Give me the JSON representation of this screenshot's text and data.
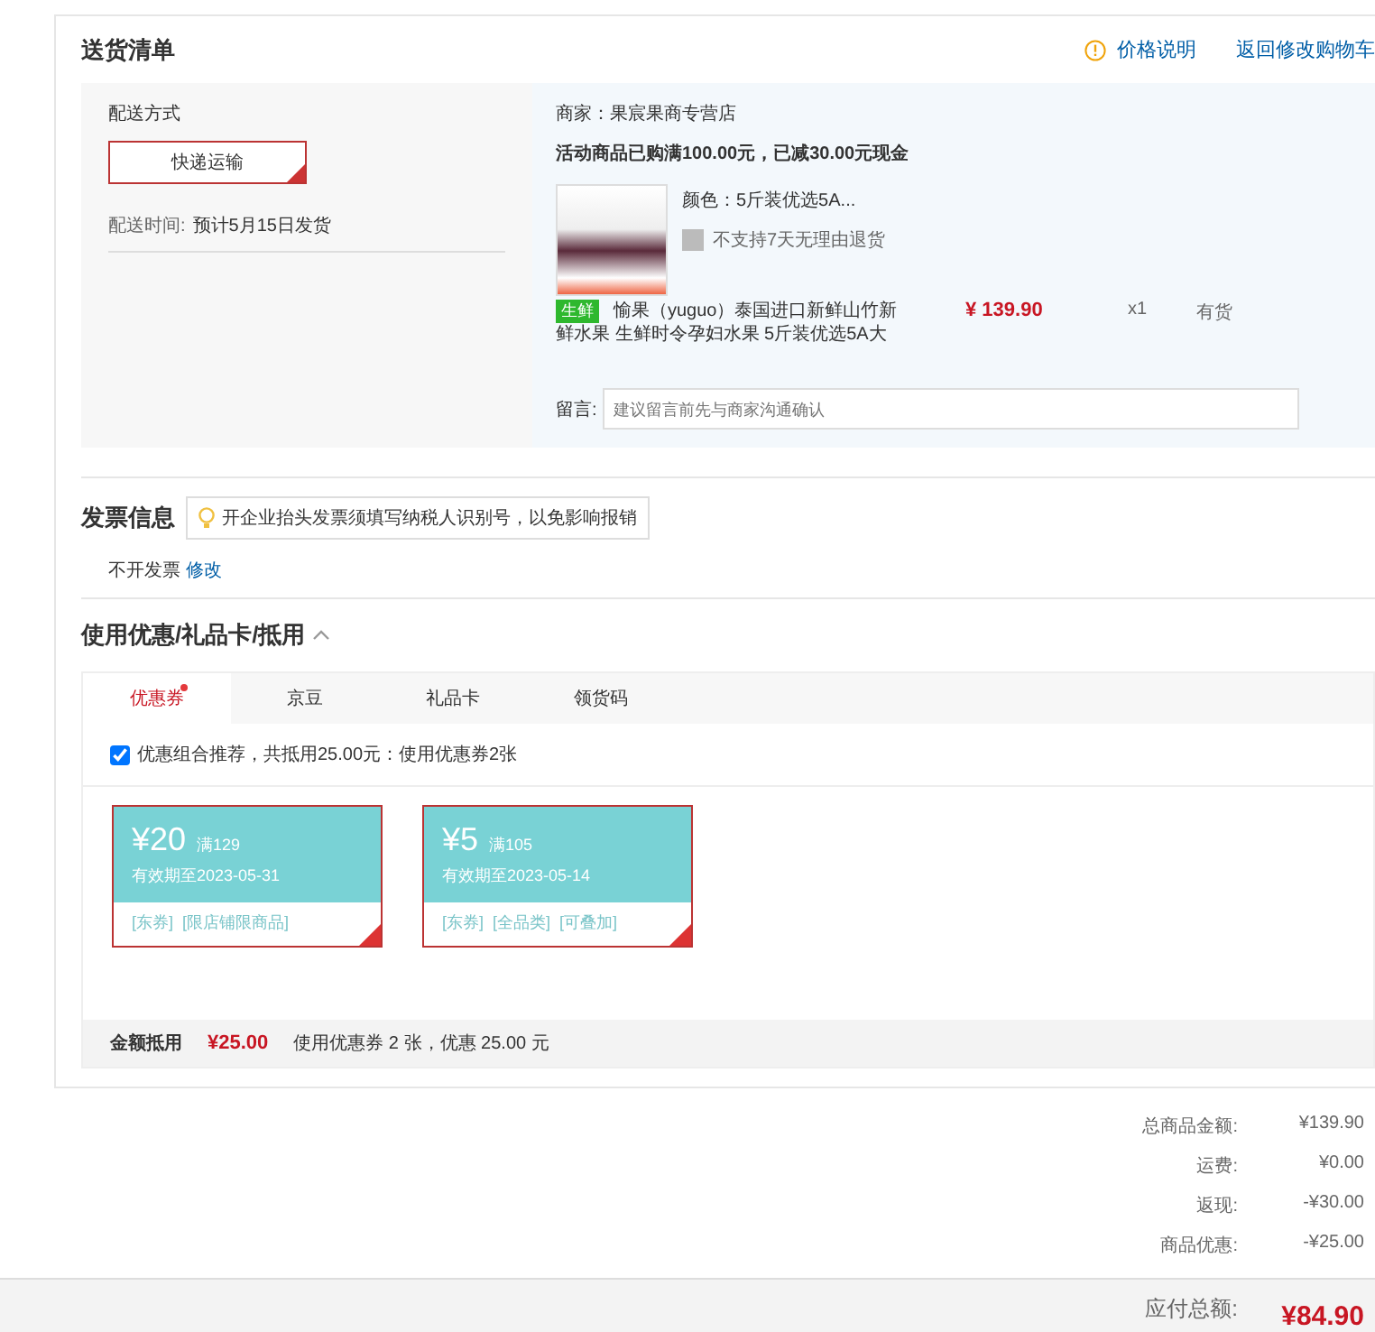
{
  "delivery": {
    "title": "送货清单",
    "links": [
      {
        "kind": "info",
        "label": "价格说明"
      },
      {
        "kind": "plain",
        "label": "返回修改购物车"
      }
    ],
    "shipping": {
      "label": "配送方式",
      "option": "快递运输",
      "selected": true,
      "time_label": "配送时间:",
      "time_value": "预计5月15日发货"
    },
    "shop": {
      "merchant": "商家：果宸果商专营店",
      "promo": "活动商品已购满100.00元，已减30.00元现金",
      "item": {
        "spec": "颜色：5斤装优选5A...",
        "no_return": "不支持7天无理由退货",
        "tag": "生鲜",
        "name": "愉果（yuguo）泰国进口新鲜山竹新鲜水果 生鲜时令孕妇水果 5斤装优选5A大",
        "price": "¥ 139.90",
        "qty": "x1",
        "stock": "有货"
      },
      "note_label": "留言:",
      "note_placeholder": "建议留言前先与商家沟通确认"
    }
  },
  "invoice": {
    "title": "发票信息",
    "tip": "开企业抬头发票须填写纳税人识别号，以免影响报销",
    "value": "不开发票",
    "edit": "修改"
  },
  "discount": {
    "title": "使用优惠/礼品卡/抵用",
    "expanded": true,
    "tabs": [
      {
        "label": "优惠券",
        "selected": true,
        "dot": true
      },
      {
        "label": "京豆",
        "selected": false,
        "dot": false
      },
      {
        "label": "礼品卡",
        "selected": false,
        "dot": false
      },
      {
        "label": "领货码",
        "selected": false,
        "dot": false
      }
    ],
    "recommend": {
      "checked": true,
      "text": "优惠组合推荐，共抵用25.00元：使用优惠券2张"
    },
    "coupons": [
      {
        "amount": "¥20",
        "condition": "满129",
        "expiry": "有效期至2023-05-31",
        "tags": [
          "[东券]",
          "[限店铺限商品]"
        ],
        "selected": true
      },
      {
        "amount": "¥5",
        "condition": "满105",
        "expiry": "有效期至2023-05-14",
        "tags": [
          "[东券]",
          "[全品类]",
          "[可叠加]"
        ],
        "selected": true
      }
    ],
    "footer_label": "金额抵用",
    "footer_amount": "¥25.00",
    "footer_note": "使用优惠券 2 张，优惠 25.00 元"
  },
  "summary": [
    {
      "label": "总商品金额:",
      "value": "¥139.90"
    },
    {
      "label": "运费:",
      "value": "¥0.00"
    },
    {
      "label": "返现:",
      "value": "-¥30.00"
    },
    {
      "label": "商品优惠:",
      "value": "-¥25.00"
    }
  ],
  "total": {
    "label": "应付总额:",
    "value": "¥84.90"
  }
}
